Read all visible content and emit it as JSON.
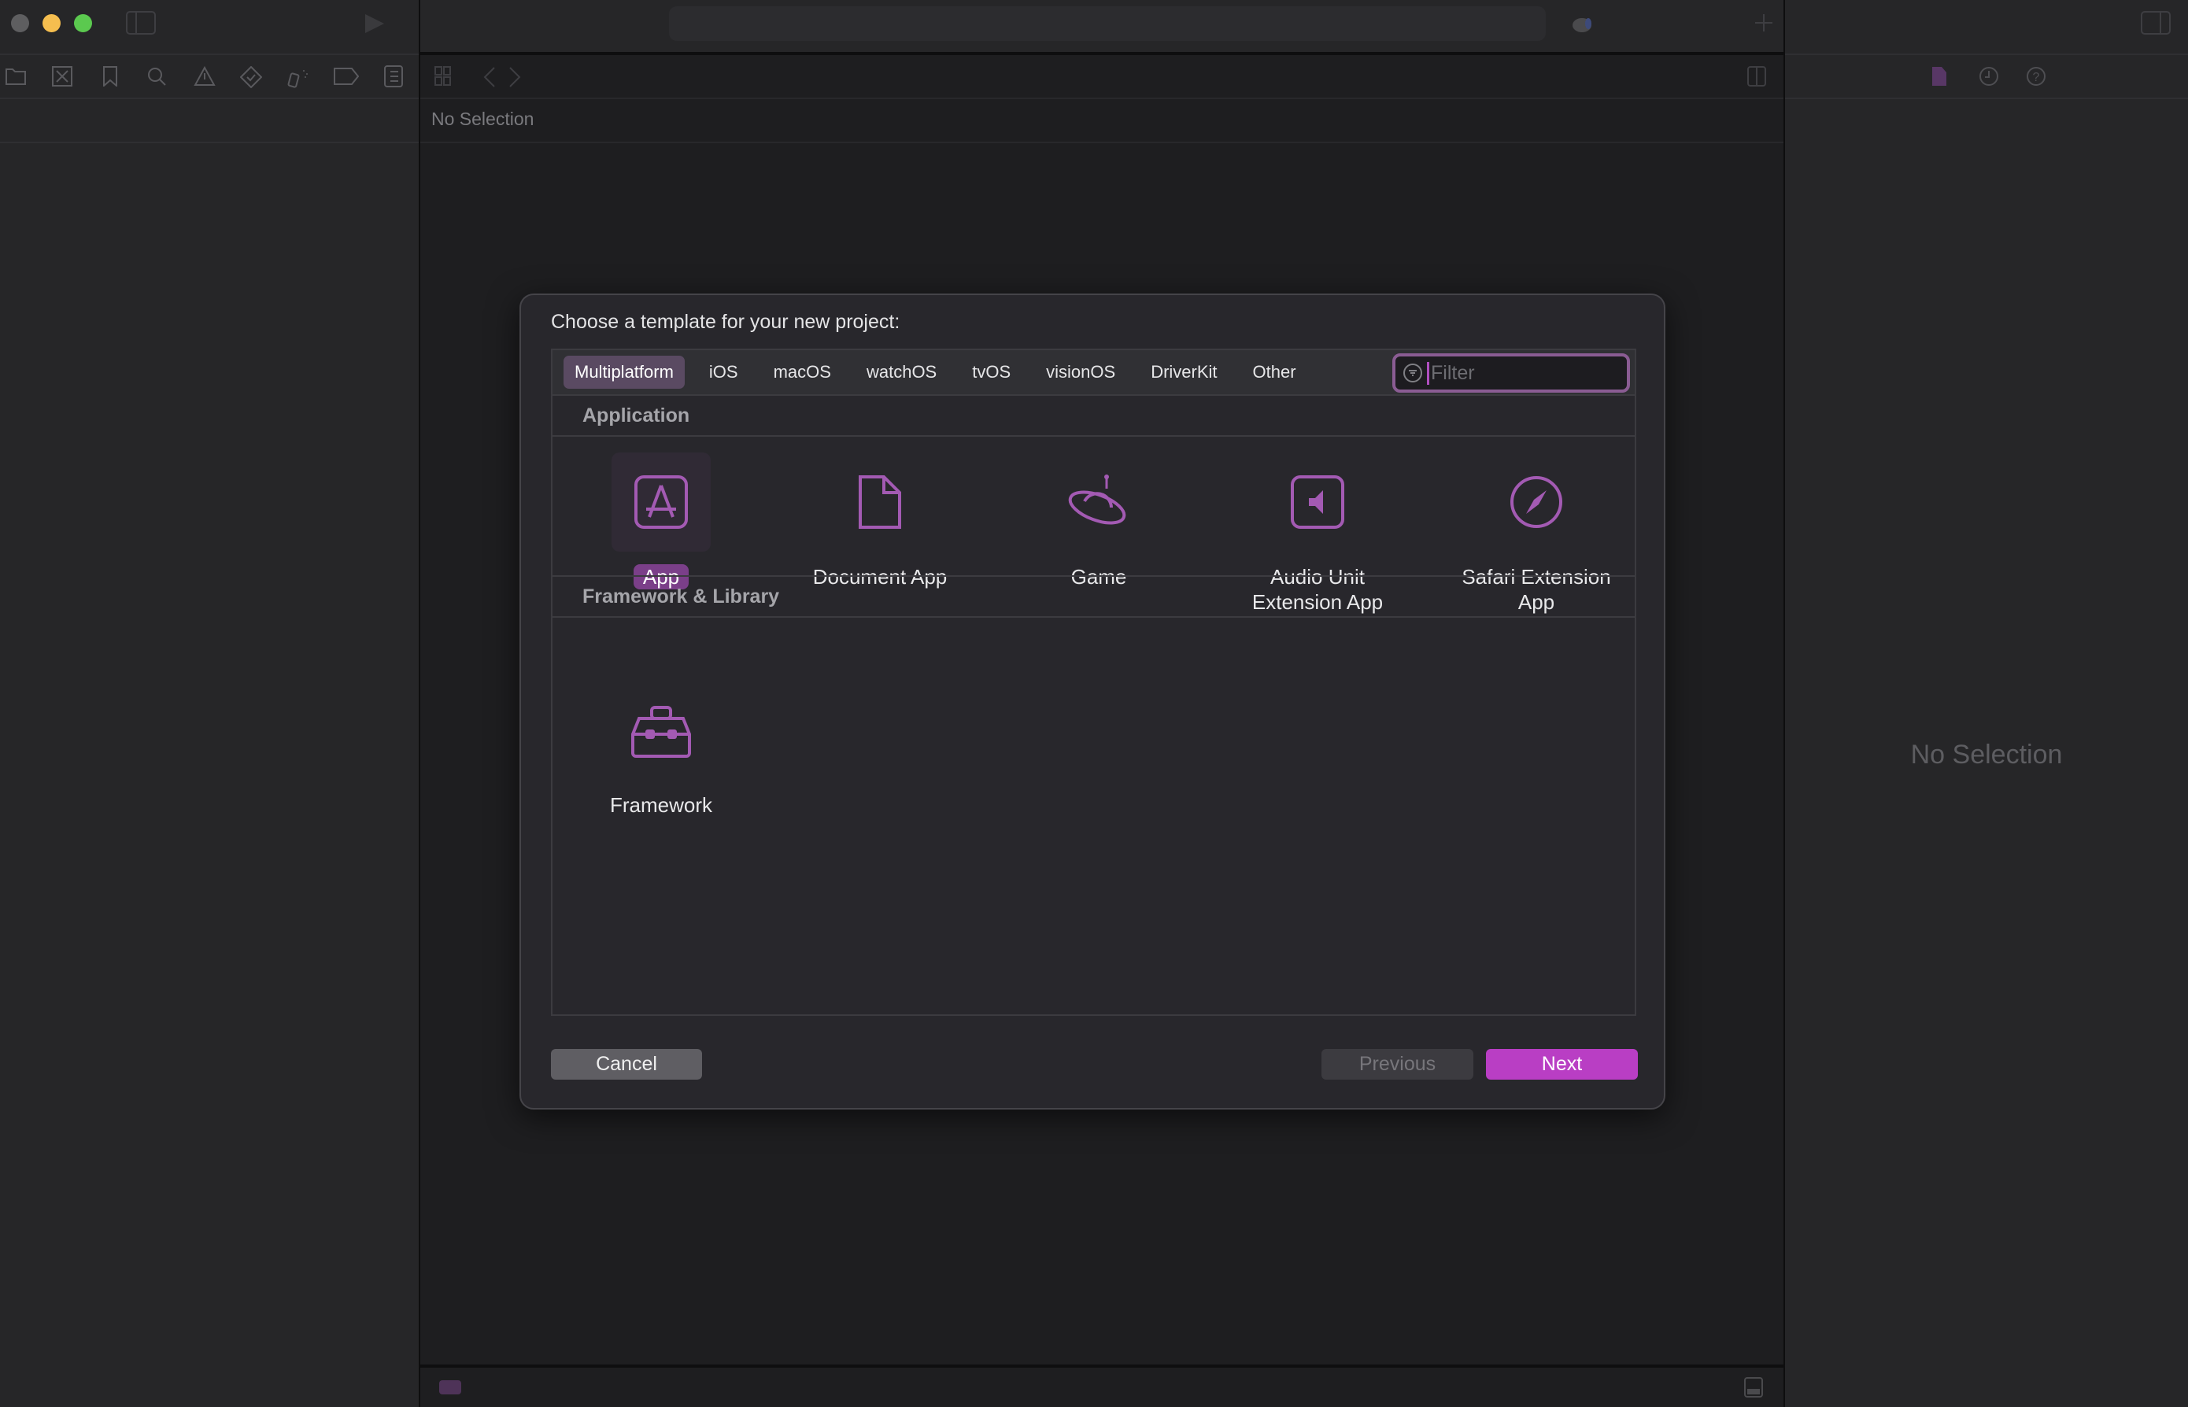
{
  "window": {
    "traffic_lights": {
      "close": "#5e5e60",
      "minimize": "#f5be4f",
      "maximize": "#5bc94f"
    },
    "toolbar": {
      "navigator_toggle": "sidebar-left-icon",
      "run": "play-icon",
      "add": "plus-icon",
      "inspector_toggle": "sidebar-right-icon"
    },
    "navigator_tabs": [
      "folder-icon",
      "source-control-icon",
      "bookmark-icon",
      "search-icon",
      "warning-icon",
      "test-icon",
      "debug-icon",
      "breakpoint-icon",
      "report-icon"
    ],
    "editor": {
      "jump_bar_text": "No Selection"
    },
    "inspector": {
      "tabs": [
        "file-icon",
        "history-icon",
        "help-icon"
      ],
      "empty_text": "No Selection"
    }
  },
  "dialog": {
    "title": "Choose a template for your new project:",
    "tabs": [
      {
        "label": "Multiplatform",
        "selected": true
      },
      {
        "label": "iOS"
      },
      {
        "label": "macOS"
      },
      {
        "label": "watchOS"
      },
      {
        "label": "tvOS"
      },
      {
        "label": "visionOS"
      },
      {
        "label": "DriverKit"
      },
      {
        "label": "Other"
      }
    ],
    "filter": {
      "placeholder": "Filter",
      "value": ""
    },
    "sections": [
      {
        "title": "Application",
        "templates": [
          {
            "label": "App",
            "icon": "app-store-icon",
            "selected": true
          },
          {
            "label": "Document App",
            "icon": "document-icon"
          },
          {
            "label": "Game",
            "icon": "ufo-icon"
          },
          {
            "label": "Audio Unit\nExtension App",
            "icon": "speaker-icon"
          },
          {
            "label": "Safari Extension\nApp",
            "icon": "compass-icon"
          }
        ]
      },
      {
        "title": "Framework & Library",
        "templates": [
          {
            "label": "Framework",
            "icon": "toolbox-icon"
          }
        ]
      }
    ],
    "buttons": {
      "cancel": "Cancel",
      "previous": "Previous",
      "next": "Next"
    },
    "accent": "#b93ec4"
  }
}
